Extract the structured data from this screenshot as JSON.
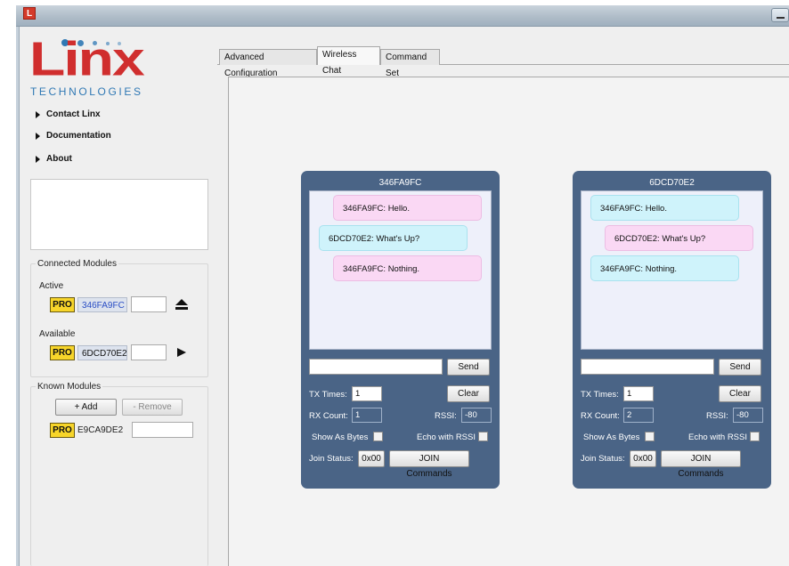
{
  "window": {
    "icon_letter": "L"
  },
  "logo": {
    "name": "Linx",
    "tagline": "TECHNOLOGIES"
  },
  "nav": [
    {
      "label": "Contact Linx"
    },
    {
      "label": "Documentation"
    },
    {
      "label": "About"
    }
  ],
  "connected_modules": {
    "title": "Connected Modules",
    "active_label": "Active",
    "active": {
      "badge": "PRO",
      "id": "346FA9FC"
    },
    "available_label": "Available",
    "available": {
      "badge": "PRO",
      "id": "6DCD70E2"
    }
  },
  "known_modules": {
    "title": "Known Modules",
    "add_label": "+ Add",
    "remove_label": "- Remove",
    "item": {
      "badge": "PRO",
      "id": "E9CA9DE2"
    }
  },
  "tabs": [
    {
      "label": "Advanced Configuration"
    },
    {
      "label": "Wireless Chat",
      "selected": true
    },
    {
      "label": "Command Set"
    }
  ],
  "chats": [
    {
      "title": "346FA9FC",
      "messages": [
        {
          "text": "346FA9FC: Hello.",
          "color": "pink"
        },
        {
          "text": "6DCD70E2: What's Up?",
          "color": "cyan"
        },
        {
          "text": "346FA9FC: Nothing.",
          "color": "pink"
        }
      ],
      "send_label": "Send",
      "tx_times_label": "TX Times:",
      "tx_times_value": "1",
      "clear_label": "Clear",
      "rx_count_label": "RX Count:",
      "rx_count_value": "1",
      "rssi_label": "RSSI:",
      "rssi_value": "-80",
      "show_as_bytes_label": "Show As Bytes",
      "echo_rssi_label": "Echo with RSSI",
      "join_status_label": "Join Status:",
      "join_status_value": "0x00",
      "join_commands_label": "JOIN Commands"
    },
    {
      "title": "6DCD70E2",
      "messages": [
        {
          "text": "346FA9FC: Hello.",
          "color": "cyan"
        },
        {
          "text": "6DCD70E2: What's Up?",
          "color": "pink"
        },
        {
          "text": "346FA9FC: Nothing.",
          "color": "cyan"
        }
      ],
      "send_label": "Send",
      "tx_times_label": "TX Times:",
      "tx_times_value": "1",
      "clear_label": "Clear",
      "rx_count_label": "RX Count:",
      "rx_count_value": "2",
      "rssi_label": "RSSI:",
      "rssi_value": "-80",
      "show_as_bytes_label": "Show As Bytes",
      "echo_rssi_label": "Echo with RSSI",
      "join_status_label": "Join Status:",
      "join_status_value": "0x00",
      "join_commands_label": "JOIN Commands"
    }
  ],
  "colors": {
    "brand_red": "#d02e2e",
    "brand_blue": "#2f78b4",
    "chat_panel": "#4a6486",
    "bubble_pink": "#fad8f4",
    "bubble_cyan": "#cff3fb",
    "pro_badge": "#f7d52a"
  }
}
